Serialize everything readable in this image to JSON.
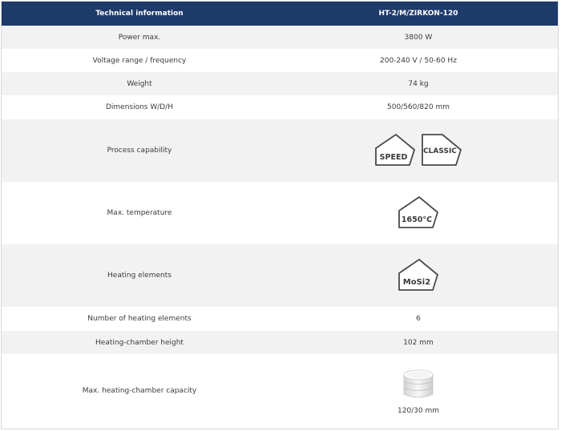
{
  "header": {
    "col1": "Technical information",
    "col2": "HT-2/M/ZIRKON-120"
  },
  "rows": [
    {
      "label": "Power max.",
      "value": "3800 W"
    },
    {
      "label": "Voltage range / frequency",
      "value": "200-240 V / 50-60 Hz"
    },
    {
      "label": "Weight",
      "value": "74 kg"
    },
    {
      "label": "Dimensions W/D/H",
      "value": "500/560/820 mm"
    },
    {
      "label": "Process capability",
      "badges": [
        "SPEED",
        "CLASSIC"
      ]
    },
    {
      "label": "Max. temperature",
      "badge": "1650°C"
    },
    {
      "label": "Heating elements",
      "badge": "MoSi2"
    },
    {
      "label": "Number of heating elements",
      "value": "6"
    },
    {
      "label": "Heating-chamber height",
      "value": "102 mm"
    },
    {
      "label": "Max. heating-chamber capacity",
      "value": "120/30 mm",
      "icon": "crucible-stack-icon"
    }
  ],
  "colors": {
    "header_bg": "#1e3a6b",
    "header_text": "#ffffff",
    "row_alt_bg": "#f2f2f2",
    "badge_stroke": "#4a4a4a"
  }
}
